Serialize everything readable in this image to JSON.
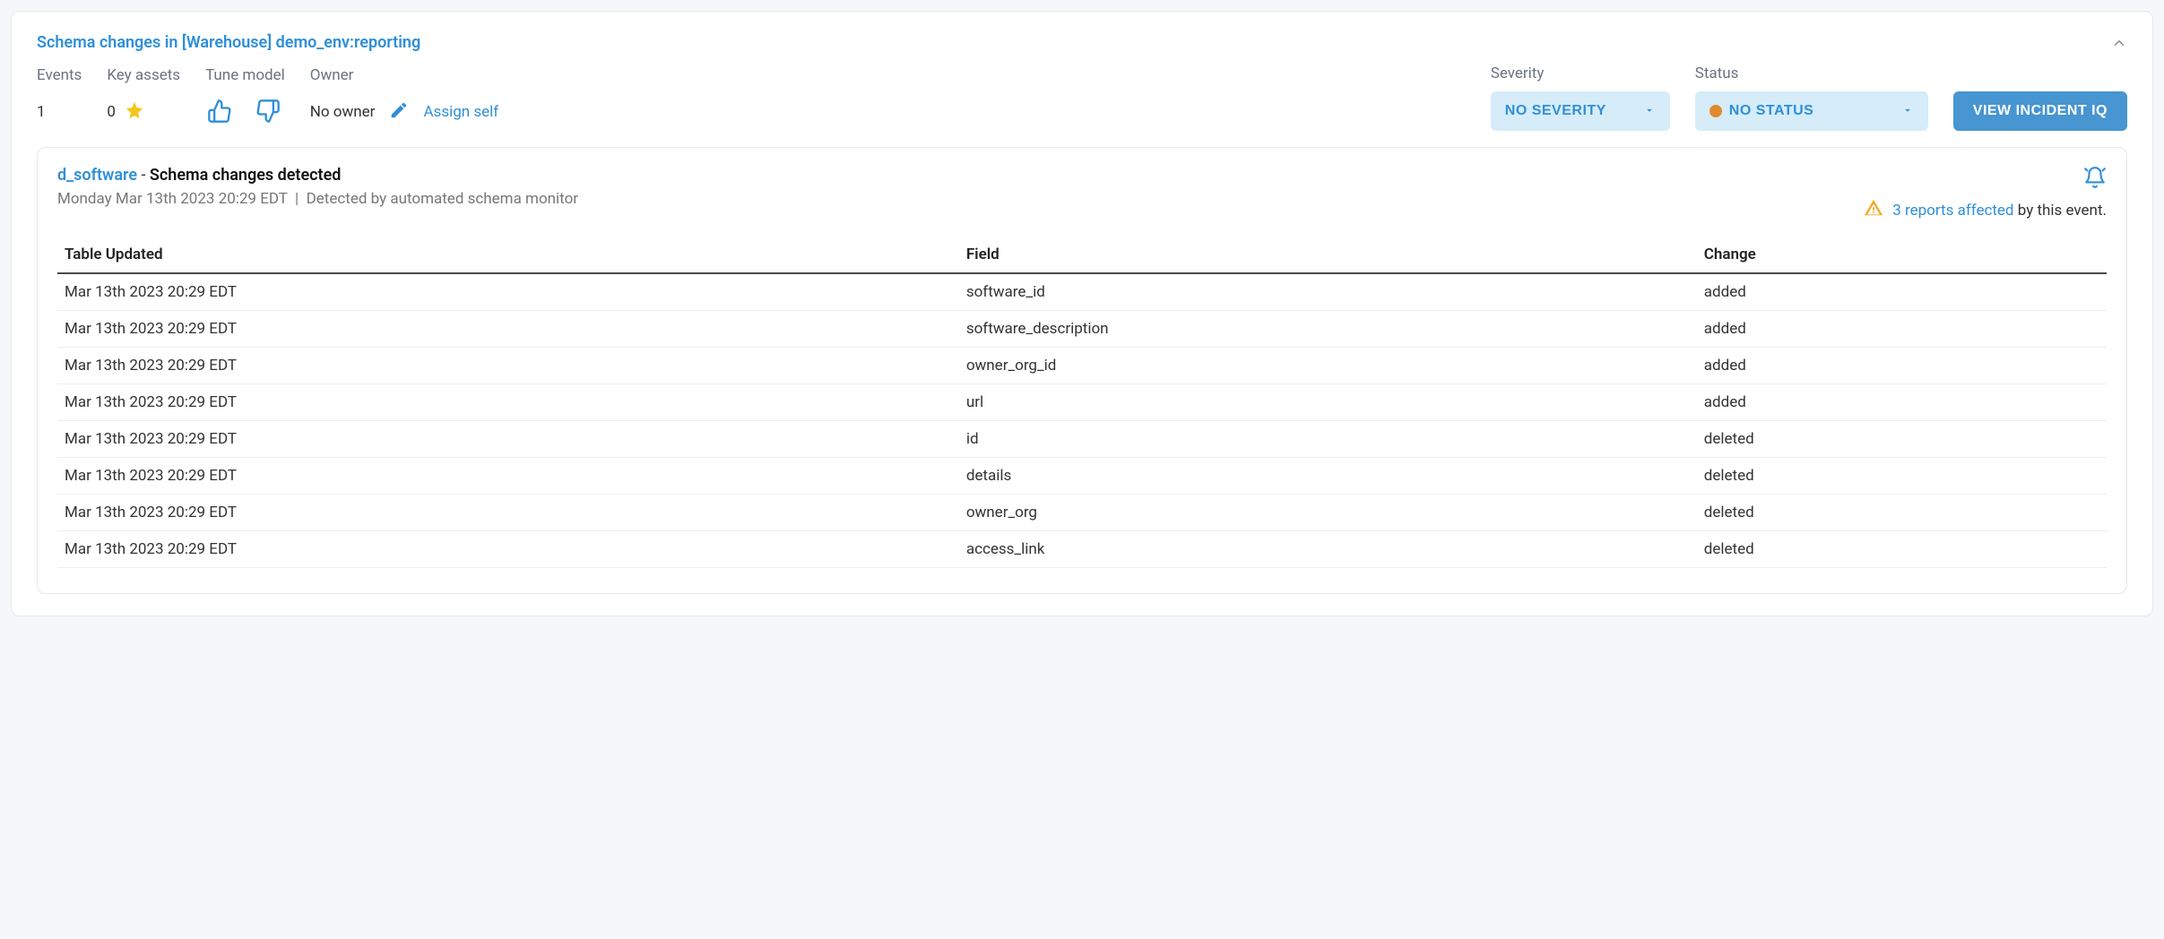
{
  "header": {
    "title": "Schema changes in [Warehouse] demo_env:reporting"
  },
  "info": {
    "events_label": "Events",
    "events_value": "1",
    "key_assets_label": "Key assets",
    "key_assets_value": "0",
    "tune_label": "Tune model",
    "owner_label": "Owner",
    "owner_value": "No owner",
    "assign_self": "Assign self",
    "severity_label": "Severity",
    "severity_value": "NO SEVERITY",
    "status_label": "Status",
    "status_value": "NO STATUS",
    "view_iq": "VIEW INCIDENT IQ"
  },
  "event": {
    "asset": "d_software",
    "sep": " - ",
    "desc": "Schema changes detected",
    "timestamp": "Monday Mar 13th 2023 20:29 EDT",
    "detected_by": "Detected by automated schema monitor",
    "affected_count": "3 reports affected",
    "affected_tail": " by this event."
  },
  "table": {
    "headers": {
      "ts": "Table Updated",
      "field": "Field",
      "change": "Change"
    },
    "rows": [
      {
        "ts": "Mar 13th 2023 20:29 EDT",
        "field": "software_id",
        "change": "added"
      },
      {
        "ts": "Mar 13th 2023 20:29 EDT",
        "field": "software_description",
        "change": "added"
      },
      {
        "ts": "Mar 13th 2023 20:29 EDT",
        "field": "owner_org_id",
        "change": "added"
      },
      {
        "ts": "Mar 13th 2023 20:29 EDT",
        "field": "url",
        "change": "added"
      },
      {
        "ts": "Mar 13th 2023 20:29 EDT",
        "field": "id",
        "change": "deleted"
      },
      {
        "ts": "Mar 13th 2023 20:29 EDT",
        "field": "details",
        "change": "deleted"
      },
      {
        "ts": "Mar 13th 2023 20:29 EDT",
        "field": "owner_org",
        "change": "deleted"
      },
      {
        "ts": "Mar 13th 2023 20:29 EDT",
        "field": "access_link",
        "change": "deleted"
      }
    ]
  }
}
